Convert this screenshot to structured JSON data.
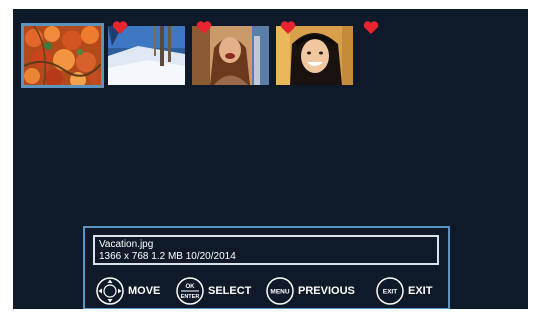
{
  "photos": [
    {
      "name": "autumn-leaves",
      "favorite": true,
      "selected": true
    },
    {
      "name": "snowy-slope",
      "favorite": true,
      "selected": false
    },
    {
      "name": "woman-laughing",
      "favorite": true,
      "selected": false
    },
    {
      "name": "smiling-girl",
      "favorite": true,
      "selected": false
    }
  ],
  "info": {
    "filename": "Vacation.jpg",
    "details": "1366 x 768   1.2 MB  10/20/2014"
  },
  "controls": {
    "move_label": "MOVE",
    "select_label": "SELECT",
    "select_icon_top": "OK",
    "select_icon_bottom": "ENTER",
    "previous_label": "PREVIOUS",
    "previous_icon": "MENU",
    "exit_label": "EXIT",
    "exit_icon": "EXIT"
  },
  "colors": {
    "background": "#0e1a2a",
    "accent": "#5b94bf",
    "heart": "#e8242e"
  }
}
